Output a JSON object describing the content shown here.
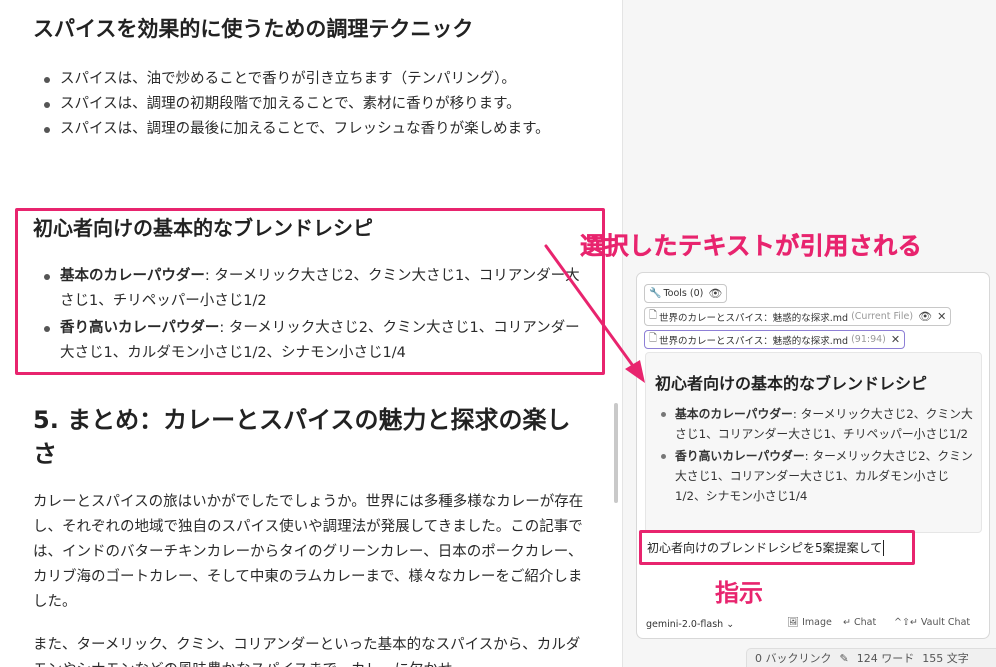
{
  "editor": {
    "section1_heading": "スパイスを効果的に使うための調理テクニック",
    "section1_bullets": [
      "スパイスは、油で炒めることで香りが引き立ちます（テンパリング）。",
      "スパイスは、調理の初期段階で加えることで、素材に香りが移ります。",
      "スパイスは、調理の最後に加えることで、フレッシュな香りが楽しめます。"
    ],
    "section2_heading": "初心者向けの基本的なブレンドレシピ",
    "section2_bullets": [
      {
        "term": "基本のカレーパウダー",
        "text": ": ターメリック大さじ2、クミン大さじ1、コリアンダー大さじ1、チリペッパー小さじ1/2"
      },
      {
        "term": "香り高いカレーパウダー",
        "text": ": ターメリック大さじ2、クミン大さじ1、コリアンダー大さじ1、カルダモン小さじ1/2、シナモン小さじ1/4"
      }
    ],
    "section3_heading": "5. まとめ：カレーとスパイスの魅力と探求の楽しさ",
    "section3_paragraph1": "カレーとスパイスの旅はいかがでしたでしょうか。世界には多種多様なカレーが存在し、それぞれの地域で独自のスパイス使いや調理法が発展してきました。この記事では、インドのバターチキンカレーからタイのグリーンカレー、日本のポークカレー、カリブ海のゴートカレー、そして中東のラムカレーまで、様々なカレーをご紹介しました。",
    "section3_paragraph2": "また、ターメリック、クミン、コリアンダーといった基本的なスパイスから、カルダモンやシナモンなどの風味豊かなスパイスまで、カレーに欠かせ"
  },
  "annotations": {
    "quoted_label": "選択したテキストが引用される",
    "instruction_label": "指示"
  },
  "chat": {
    "tools_label": "Tools (0)",
    "chip_current_file_name": "世界のカレーとスパイス：魅惑的な探求.md",
    "chip_current_file_tag": "(Current File)",
    "chip_selection_name": "世界のカレーとスパイス：魅惑的な探求.md",
    "chip_selection_range": "(91:94)",
    "quote_heading": "初心者向けの基本的なブレンドレシピ",
    "quote_bullets": [
      {
        "term": "基本のカレーパウダー",
        "text": ": ターメリック大さじ2、クミン大さじ1、コリアンダー大さじ1、チリペッパー小さじ1/2"
      },
      {
        "term": "香り高いカレーパウダー",
        "text": ": ターメリック大さじ2、クミン大さじ1、コリアンダー大さじ1、カルダモン小さじ1/2、シナモン小さじ1/4"
      }
    ],
    "input_value": "初心者向けのブレンドレシピを5案提案して",
    "model_label": "gemini-2.0-flash",
    "image_label": "Image",
    "chat_label": "Chat",
    "vault_chat_label": "Vault Chat"
  },
  "status": {
    "backlinks": "0 バックリンク",
    "words": "124 ワード",
    "chars": "155 文字"
  },
  "colors": {
    "annotation_accent": "#e8246e",
    "selection_chip_border": "#8d7fd6"
  },
  "icons": [
    "file-icon",
    "eye-icon",
    "close-icon",
    "wrench-icon",
    "image-icon",
    "enter-icon",
    "pencil-icon",
    "chevron-down-icon"
  ]
}
